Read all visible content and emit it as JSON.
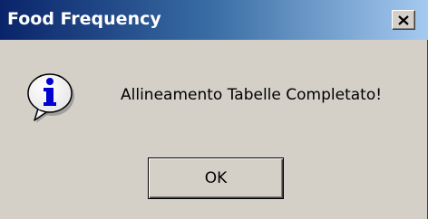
{
  "window": {
    "title": "Food Frequency",
    "close_icon": "close-icon",
    "titlebar_color_start": "#0a246a",
    "titlebar_color_end": "#a6caf0"
  },
  "dialog": {
    "icon": "info-icon",
    "message": "Allineamento Tabelle Completato!",
    "ok_label": "OK"
  }
}
